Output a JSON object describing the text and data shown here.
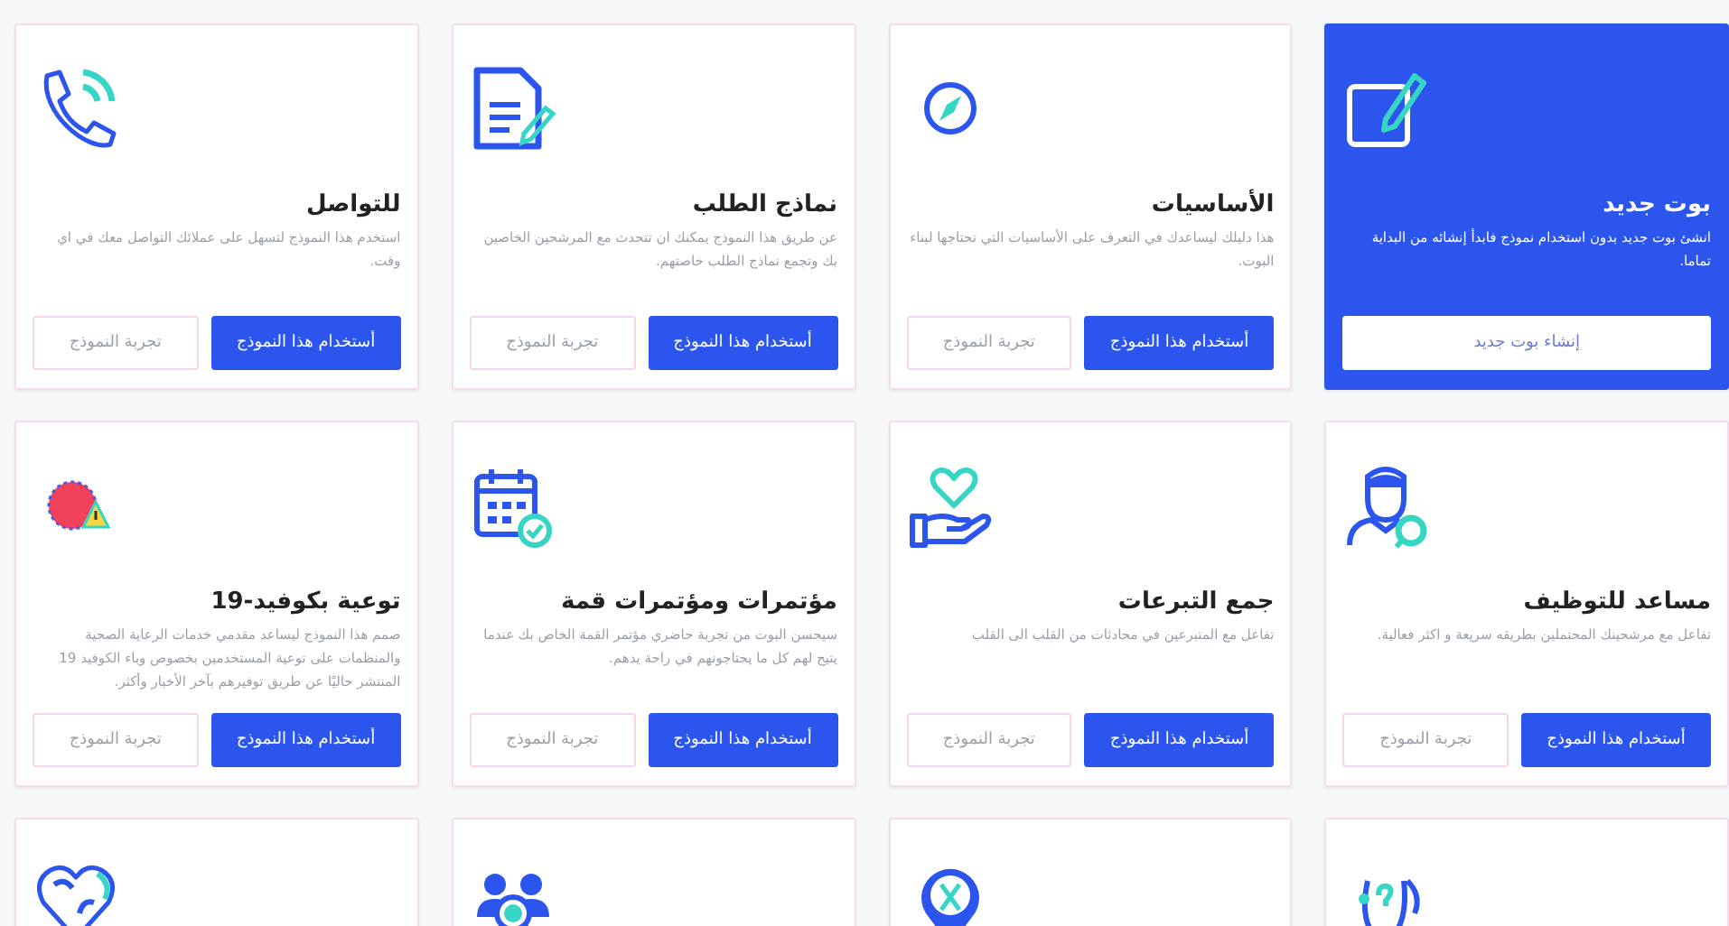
{
  "cards": [
    {
      "kind": "new",
      "title": "بوت جديد",
      "description": "انشئ بوت جديد بدون استخدام نموذج فابدأ إنشائه من البداية تماما.",
      "buttons": [
        {
          "label": "إنشاء بوت جديد",
          "kind": "light"
        }
      ]
    },
    {
      "kind": "template",
      "title": "الأساسيات",
      "description": "هذا دليلك ليساعدك في التعرف على الأساسيات التي تحتاجها لبناء البوت.",
      "buttons": [
        {
          "label": "أستخدام هذا النموذج",
          "kind": "primary"
        },
        {
          "label": "تجربة النموذج",
          "kind": "outline"
        }
      ]
    },
    {
      "kind": "template",
      "title": "نماذج الطلب",
      "description": "عن طريق هذا النموذج يمكنك ان تتحدث مع المرشحين الخاصين بك وتجمع نماذج الطلب خاصتهم.",
      "buttons": [
        {
          "label": "أستخدام هذا النموذج",
          "kind": "primary"
        },
        {
          "label": "تجربة النموذج",
          "kind": "outline"
        }
      ]
    },
    {
      "kind": "template",
      "title": "للتواصل",
      "description": "استخدم هذا النموذج لتسهل على عملائك التواصل معك في اي وقت.",
      "buttons": [
        {
          "label": "أستخدام هذا النموذج",
          "kind": "primary"
        },
        {
          "label": "تجربة النموذج",
          "kind": "outline"
        }
      ]
    },
    {
      "kind": "template",
      "title": "مساعد للتوظيف",
      "description": "تفاعل مع مرشحينك المحتملين بطريقه سريعة و اكثر فعالية.",
      "buttons": [
        {
          "label": "أستخدام هذا النموذج",
          "kind": "primary"
        },
        {
          "label": "تجربة النموذج",
          "kind": "outline"
        }
      ]
    },
    {
      "kind": "template",
      "title": "جمع التبرعات",
      "description": "تفاعل مع المتبرعين في محادثات من القلب الى القلب",
      "buttons": [
        {
          "label": "أستخدام هذا النموذج",
          "kind": "primary"
        },
        {
          "label": "تجربة النموذج",
          "kind": "outline"
        }
      ]
    },
    {
      "kind": "template",
      "title": "مؤتمرات ومؤتمرات قمة",
      "description": "سيحسن البوت من تجربة حاضري مؤتمر القمة الخاص بك عندما يتيح لهم كل ما يحتاجونهم في راحة يدهم.",
      "buttons": [
        {
          "label": "أستخدام هذا النموذج",
          "kind": "primary"
        },
        {
          "label": "تجربة النموذج",
          "kind": "outline"
        }
      ]
    },
    {
      "kind": "template",
      "title": "توعية بكوفيد-19",
      "description": "صمم هذا النموذج ليساعد مقدمي خدمات الرعاية الصحية والمنظمات على توعية المستخدمين بخصوص وباء الكوفيد 19 المنتشر حاليًا عن طريق توفيرهم بآخر الأخبار وأكثر.",
      "buttons": [
        {
          "label": "أستخدام هذا النموذج",
          "kind": "primary"
        },
        {
          "label": "تجربة النموذج",
          "kind": "outline"
        }
      ]
    },
    {
      "kind": "template"
    },
    {
      "kind": "template"
    },
    {
      "kind": "template"
    },
    {
      "kind": "template"
    }
  ]
}
